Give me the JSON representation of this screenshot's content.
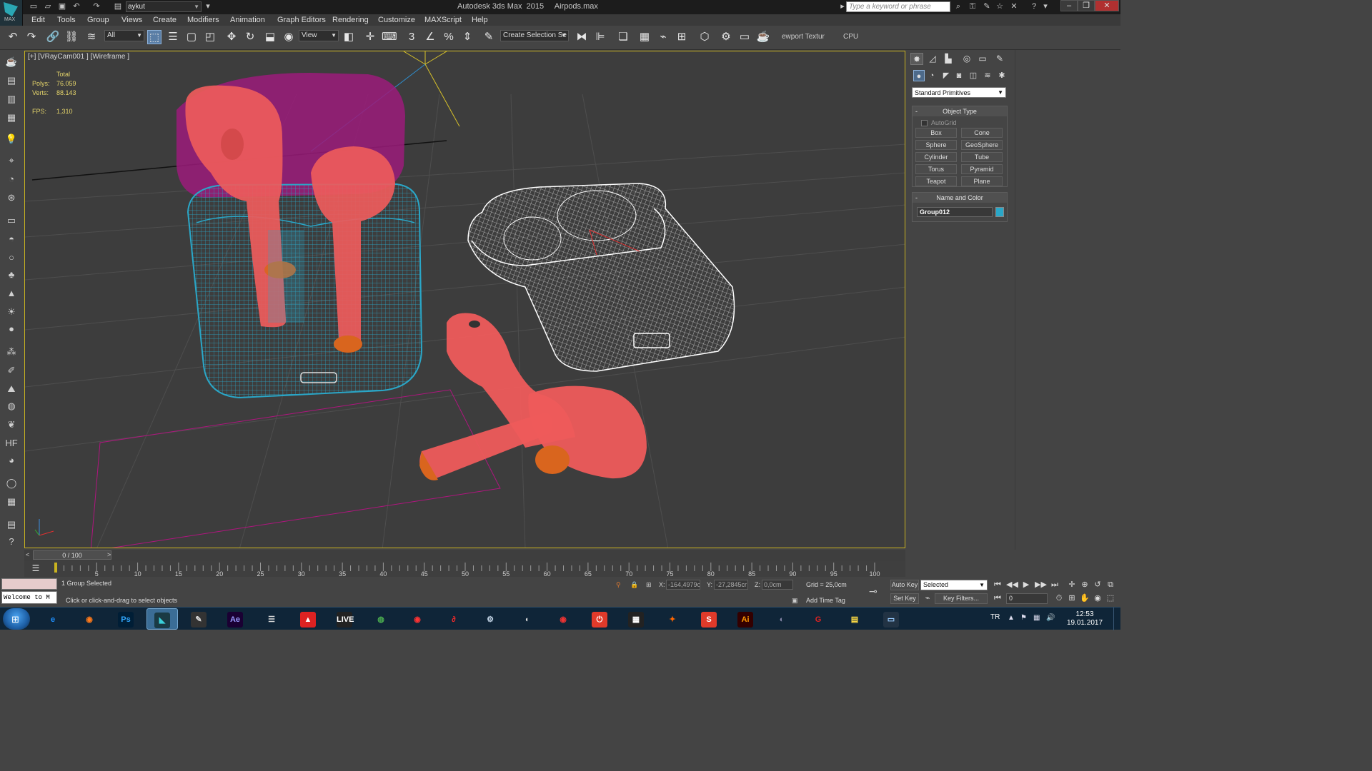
{
  "title_bar": {
    "app_title": "Autodesk 3ds Max  2015     Airpods.max",
    "project_name": "aykut",
    "search_placeholder": "Type a keyword or phrase",
    "app_logo_label": "MAX"
  },
  "menu": [
    "Edit",
    "Tools",
    "Group",
    "Views",
    "Create",
    "Modifiers",
    "Animation",
    "Graph Editors",
    "Rendering",
    "Customize",
    "MAXScript",
    "Help"
  ],
  "toolbar": {
    "selection_filter": "All",
    "reference_coord": "View",
    "named_selection_placeholder": "Create Selection Se",
    "viewport_texture_label": "ewport Textur",
    "render_device": "CPU"
  },
  "viewport": {
    "label": "[+] [VRayCam001 ] [Wireframe ]",
    "stats": {
      "total_label": "Total",
      "polys_label": "Polys:",
      "polys_value": "76.059",
      "verts_label": "Verts:",
      "verts_value": "88.143",
      "fps_label": "FPS:",
      "fps_value": "1,310"
    },
    "colors": {
      "selected_case": "#2aa7c8",
      "case_lid": "#b0157f",
      "airpods": "#ee5b5b",
      "tips": "#d9651e",
      "second_case": "#ffffff",
      "grid": "#555555",
      "border": "#c9b320"
    }
  },
  "command_panel": {
    "category": "Standard Primitives",
    "object_type": {
      "header": "Object Type",
      "autogrid_label": "AutoGrid",
      "buttons": [
        "Box",
        "Cone",
        "Sphere",
        "GeoSphere",
        "Cylinder",
        "Tube",
        "Torus",
        "Pyramid",
        "Teapot",
        "Plane"
      ]
    },
    "name_and_color": {
      "header": "Name and Color",
      "object_name": "Group012",
      "object_color": "#2aa7c8"
    }
  },
  "timeline": {
    "slider_label": "0 / 100",
    "ticks": [
      "5",
      "10",
      "15",
      "20",
      "25",
      "30",
      "35",
      "40",
      "45",
      "50",
      "55",
      "60",
      "65",
      "70",
      "75",
      "80",
      "85",
      "90",
      "95",
      "100"
    ]
  },
  "status_bar": {
    "listener_text": "Welcome to M",
    "selection_text": "1 Group Selected",
    "prompt_text": "Click or click-and-drag to select objects",
    "x_label": "X:",
    "x_value": "-164,4979c",
    "y_label": "Y:",
    "y_value": "-27,2845cr",
    "z_label": "Z:",
    "z_value": "0,0cm",
    "grid_text": "Grid = 25,0cm",
    "add_time_tag": "Add Time Tag",
    "auto_key": "Auto Key",
    "set_key": "Set Key",
    "key_mode": "Selected",
    "key_filters": "Key Filters...",
    "current_frame": "0"
  },
  "taskbar": {
    "apps": [
      "Internet Explorer",
      "Firefox",
      "Photoshop",
      "3ds Max",
      "Notes",
      "After Effects",
      "Character Studio",
      "Acrobat",
      "Live",
      "Utorrent",
      "Chrome Canary",
      "Daz",
      "Steam",
      "Logitech",
      "Opera",
      "Power",
      "Movie Maker",
      "Hash",
      "Substance",
      "Illustrator",
      "Cinema 4D",
      "G-Hub",
      "Explorer",
      "Display"
    ],
    "language": "TR",
    "time": "12:53",
    "date": "19.01.2017"
  }
}
